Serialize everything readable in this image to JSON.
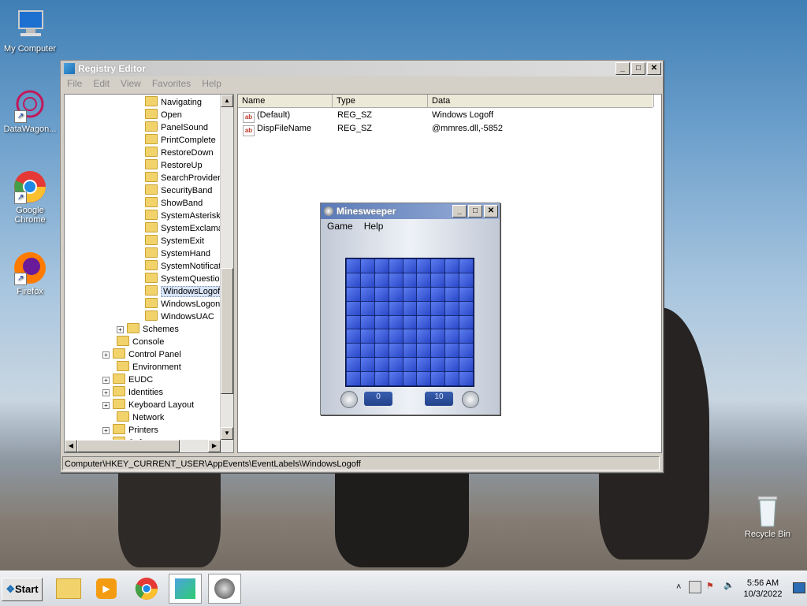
{
  "desktop": {
    "icons": [
      {
        "label": "My Computer"
      },
      {
        "label": "DataWagon..."
      },
      {
        "label": "Google Chrome"
      },
      {
        "label": "Firefox"
      },
      {
        "label": "Recycle Bin"
      }
    ]
  },
  "regedit": {
    "title": "Registry Editor",
    "menu": [
      "File",
      "Edit",
      "View",
      "Favorites",
      "Help"
    ],
    "tree": [
      {
        "label": "Navigating",
        "level": 3
      },
      {
        "label": "Open",
        "level": 3
      },
      {
        "label": "PanelSound",
        "level": 3
      },
      {
        "label": "PrintComplete",
        "level": 3
      },
      {
        "label": "RestoreDown",
        "level": 3
      },
      {
        "label": "RestoreUp",
        "level": 3
      },
      {
        "label": "SearchProviderD",
        "level": 3
      },
      {
        "label": "SecurityBand",
        "level": 3
      },
      {
        "label": "ShowBand",
        "level": 3
      },
      {
        "label": "SystemAsterisk",
        "level": 3
      },
      {
        "label": "SystemExclamat",
        "level": 3
      },
      {
        "label": "SystemExit",
        "level": 3
      },
      {
        "label": "SystemHand",
        "level": 3
      },
      {
        "label": "SystemNotificati",
        "level": 3
      },
      {
        "label": "SystemQuestion",
        "level": 3
      },
      {
        "label": "WindowsLogoff",
        "level": 3,
        "selected": true
      },
      {
        "label": "WindowsLogon",
        "level": 3
      },
      {
        "label": "WindowsUAC",
        "level": 3
      },
      {
        "label": "Schemes",
        "level": 2,
        "expandable": true
      },
      {
        "label": "Console",
        "level": 1
      },
      {
        "label": "Control Panel",
        "level": 1,
        "expandable": true
      },
      {
        "label": "Environment",
        "level": 1
      },
      {
        "label": "EUDC",
        "level": 1,
        "expandable": true
      },
      {
        "label": "Identities",
        "level": 1,
        "expandable": true
      },
      {
        "label": "Keyboard Layout",
        "level": 1,
        "expandable": true
      },
      {
        "label": "Network",
        "level": 1
      },
      {
        "label": "Printers",
        "level": 1,
        "expandable": true
      },
      {
        "label": "Software",
        "level": 1,
        "expandable": true
      }
    ],
    "columns": [
      "Name",
      "Type",
      "Data"
    ],
    "values": [
      {
        "name": "(Default)",
        "type": "REG_SZ",
        "data": "Windows Logoff"
      },
      {
        "name": "DispFileName",
        "type": "REG_SZ",
        "data": "@mmres.dll,-5852"
      }
    ],
    "status": "Computer\\HKEY_CURRENT_USER\\AppEvents\\EventLabels\\WindowsLogoff"
  },
  "minesweeper": {
    "title": "Minesweeper",
    "menu": [
      "Game",
      "Help"
    ],
    "timer": "0",
    "mines": "10",
    "rows": 9,
    "cols": 9
  },
  "taskbar": {
    "start_label": "Start",
    "time": "5:56 AM",
    "date": "10/3/2022"
  },
  "colors": {
    "tree_folder": "#f2d36b",
    "mine_tile": "#3f5ee0",
    "title_active": "#5a7ab8"
  }
}
